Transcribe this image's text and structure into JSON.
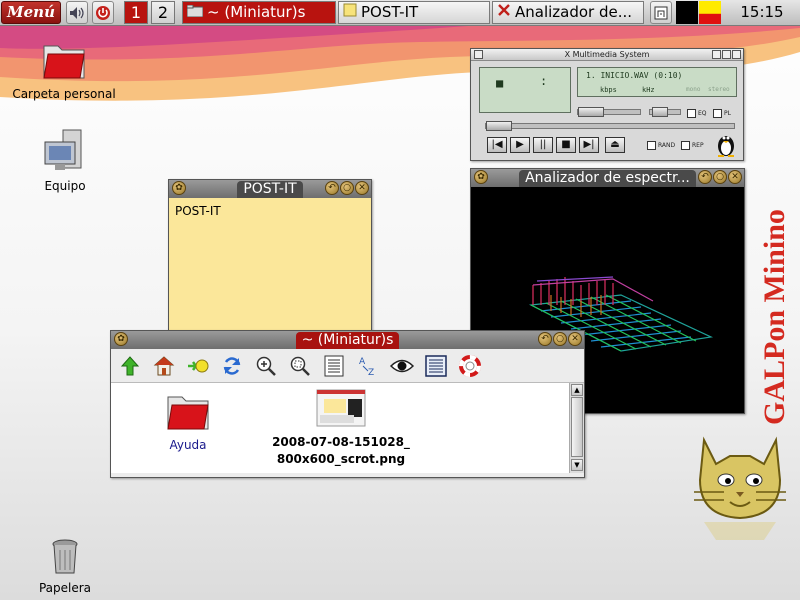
{
  "taskbar": {
    "menu_label": "Menú",
    "workspaces": [
      "1",
      "2"
    ],
    "tasks": [
      {
        "label": "~ (Miniatur)s",
        "state": "active",
        "icon": "folder-icon"
      },
      {
        "label": "POST-IT",
        "state": "inactive",
        "icon": "note-icon"
      },
      {
        "label": "Analizador de...",
        "state": "inactive",
        "icon": "x-icon"
      }
    ],
    "clock": "15:15"
  },
  "desktop": {
    "icons": [
      {
        "label": "Carpeta personal",
        "icon": "folder-icon"
      },
      {
        "label": "Equipo",
        "icon": "computer-icon"
      },
      {
        "label": "Papelera",
        "icon": "trash-icon"
      }
    ],
    "branding": "GALPon Minino"
  },
  "postit": {
    "title": "POST-IT",
    "content": "POST-IT",
    "bg_color": "#fbe79a"
  },
  "xmms": {
    "title": "X Multimedia System",
    "track": "1. INICIO.WAV (0:10)",
    "kbps_label": "kbps",
    "khz_label": "kHz",
    "mono_label": "mono",
    "stereo_label": "stereo",
    "eq_label": "EQ",
    "pl_label": "PL",
    "rand_label": "RAND",
    "rep_label": "REP"
  },
  "spectrum": {
    "title": "Analizador de espectr..."
  },
  "filemanager": {
    "title": "~ (Miniatur)s",
    "toolbar": [
      "up-arrow-icon",
      "home-icon",
      "bookmark-icon",
      "refresh-icon",
      "zoom-in-icon",
      "zoom-fit-icon",
      "details-view-icon",
      "sort-az-icon",
      "eye-icon",
      "list-view-icon",
      "help-icon"
    ],
    "items": [
      {
        "label": "Ayuda",
        "icon": "folder-icon"
      },
      {
        "label_line1": "2008-07-08-151028_",
        "label_line2": "800x600_scrot.png",
        "icon": "image-thumbnail-icon"
      }
    ]
  },
  "colors": {
    "accent_red": "#b8130f",
    "link_blue": "#1a1a8c"
  }
}
